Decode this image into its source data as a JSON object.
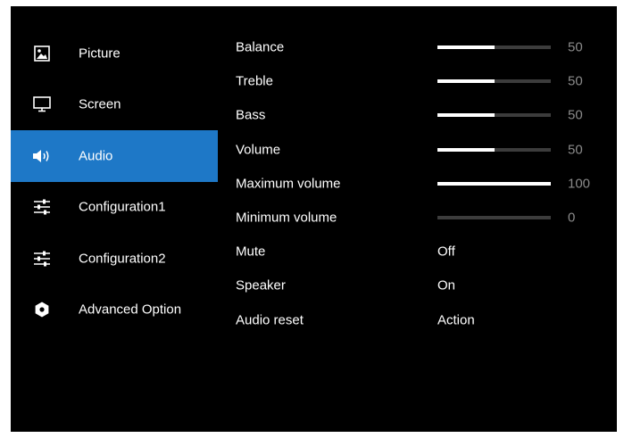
{
  "colors": {
    "selected_bg": "#1e78c7",
    "screen_bg": "#000000",
    "text": "#ffffff",
    "value_text": "#8a8a8a",
    "slider_track": "#3c3c3c",
    "slider_fill": "#ffffff"
  },
  "sidebar": {
    "items": [
      {
        "label": "Picture",
        "icon": "picture-icon",
        "selected": false
      },
      {
        "label": "Screen",
        "icon": "monitor-icon",
        "selected": false
      },
      {
        "label": "Audio",
        "icon": "speaker-icon",
        "selected": true
      },
      {
        "label": "Configuration1",
        "icon": "sliders-icon",
        "selected": false
      },
      {
        "label": "Configuration2",
        "icon": "sliders-icon",
        "selected": false
      },
      {
        "label": "Advanced Option",
        "icon": "gear-icon",
        "selected": false
      }
    ]
  },
  "settings": {
    "balance": {
      "label": "Balance",
      "value": "50",
      "level": 0.5
    },
    "treble": {
      "label": "Treble",
      "value": "50",
      "level": 0.5
    },
    "bass": {
      "label": "Bass",
      "value": "50",
      "level": 0.5
    },
    "volume": {
      "label": "Volume",
      "value": "50",
      "level": 0.5
    },
    "max_volume": {
      "label": "Maximum volume",
      "value": "100",
      "level": 1.0
    },
    "min_volume": {
      "label": "Minimum volume",
      "value": "0",
      "level": 0.0
    },
    "mute": {
      "label": "Mute",
      "value": "Off"
    },
    "speaker": {
      "label": "Speaker",
      "value": "On"
    },
    "audio_reset": {
      "label": "Audio reset",
      "value": "Action"
    }
  }
}
